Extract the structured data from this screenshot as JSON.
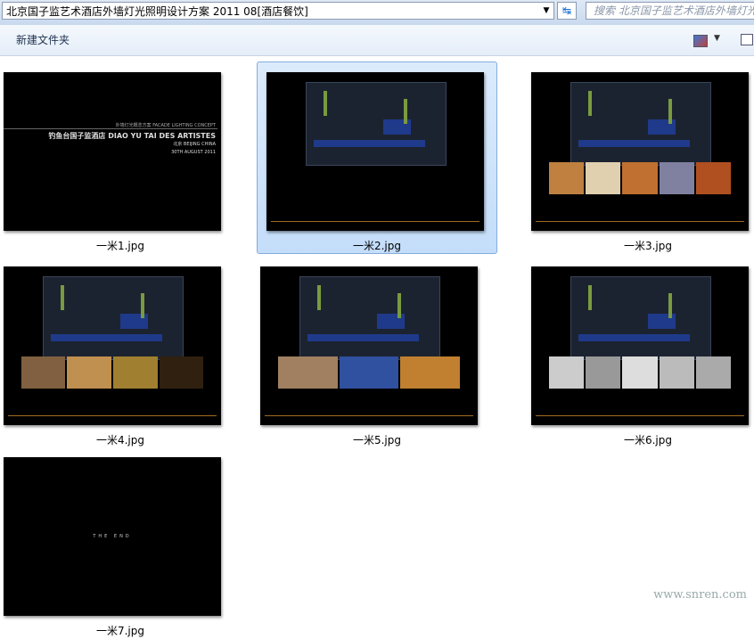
{
  "address": {
    "path": "北京国子监艺术酒店外墙灯光照明设计方案 2011 08[酒店餐饮]",
    "search_placeholder": "搜索 北京国子监艺术酒店外墙灯光"
  },
  "toolbar": {
    "new_folder": "新建文件夹"
  },
  "files": [
    {
      "name": "一米1.jpg"
    },
    {
      "name": "一米2.jpg",
      "selected": true
    },
    {
      "name": "一米3.jpg"
    },
    {
      "name": "一米4.jpg"
    },
    {
      "name": "一米5.jpg"
    },
    {
      "name": "一米6.jpg"
    },
    {
      "name": "一米7.jpg"
    }
  ],
  "cover": {
    "subtitle": "外墙灯光概念方案 FACADE LIGHTING CONCEPT",
    "title": "钓鱼台国子监酒店 DIAO YU TAI DES ARTISTES",
    "location": "北京 BEIJING CHINA",
    "date": "30TH AUGUST 2011"
  },
  "end_text": "THE END",
  "watermark": "www.snren.com"
}
